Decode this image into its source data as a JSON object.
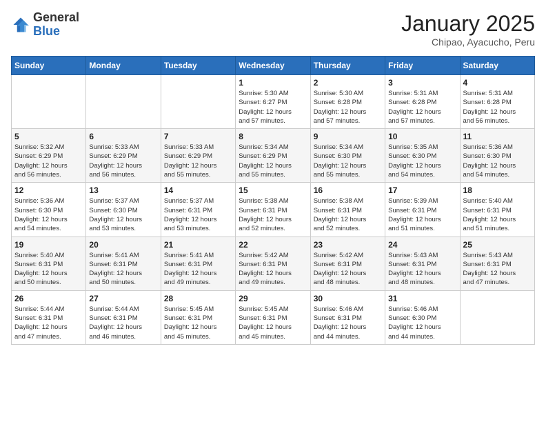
{
  "logo": {
    "general": "General",
    "blue": "Blue"
  },
  "header": {
    "month": "January 2025",
    "location": "Chipao, Ayacucho, Peru"
  },
  "days_of_week": [
    "Sunday",
    "Monday",
    "Tuesday",
    "Wednesday",
    "Thursday",
    "Friday",
    "Saturday"
  ],
  "weeks": [
    [
      {
        "day": "",
        "info": ""
      },
      {
        "day": "",
        "info": ""
      },
      {
        "day": "",
        "info": ""
      },
      {
        "day": "1",
        "info": "Sunrise: 5:30 AM\nSunset: 6:27 PM\nDaylight: 12 hours\nand 57 minutes."
      },
      {
        "day": "2",
        "info": "Sunrise: 5:30 AM\nSunset: 6:28 PM\nDaylight: 12 hours\nand 57 minutes."
      },
      {
        "day": "3",
        "info": "Sunrise: 5:31 AM\nSunset: 6:28 PM\nDaylight: 12 hours\nand 57 minutes."
      },
      {
        "day": "4",
        "info": "Sunrise: 5:31 AM\nSunset: 6:28 PM\nDaylight: 12 hours\nand 56 minutes."
      }
    ],
    [
      {
        "day": "5",
        "info": "Sunrise: 5:32 AM\nSunset: 6:29 PM\nDaylight: 12 hours\nand 56 minutes."
      },
      {
        "day": "6",
        "info": "Sunrise: 5:33 AM\nSunset: 6:29 PM\nDaylight: 12 hours\nand 56 minutes."
      },
      {
        "day": "7",
        "info": "Sunrise: 5:33 AM\nSunset: 6:29 PM\nDaylight: 12 hours\nand 55 minutes."
      },
      {
        "day": "8",
        "info": "Sunrise: 5:34 AM\nSunset: 6:29 PM\nDaylight: 12 hours\nand 55 minutes."
      },
      {
        "day": "9",
        "info": "Sunrise: 5:34 AM\nSunset: 6:30 PM\nDaylight: 12 hours\nand 55 minutes."
      },
      {
        "day": "10",
        "info": "Sunrise: 5:35 AM\nSunset: 6:30 PM\nDaylight: 12 hours\nand 54 minutes."
      },
      {
        "day": "11",
        "info": "Sunrise: 5:36 AM\nSunset: 6:30 PM\nDaylight: 12 hours\nand 54 minutes."
      }
    ],
    [
      {
        "day": "12",
        "info": "Sunrise: 5:36 AM\nSunset: 6:30 PM\nDaylight: 12 hours\nand 54 minutes."
      },
      {
        "day": "13",
        "info": "Sunrise: 5:37 AM\nSunset: 6:30 PM\nDaylight: 12 hours\nand 53 minutes."
      },
      {
        "day": "14",
        "info": "Sunrise: 5:37 AM\nSunset: 6:31 PM\nDaylight: 12 hours\nand 53 minutes."
      },
      {
        "day": "15",
        "info": "Sunrise: 5:38 AM\nSunset: 6:31 PM\nDaylight: 12 hours\nand 52 minutes."
      },
      {
        "day": "16",
        "info": "Sunrise: 5:38 AM\nSunset: 6:31 PM\nDaylight: 12 hours\nand 52 minutes."
      },
      {
        "day": "17",
        "info": "Sunrise: 5:39 AM\nSunset: 6:31 PM\nDaylight: 12 hours\nand 51 minutes."
      },
      {
        "day": "18",
        "info": "Sunrise: 5:40 AM\nSunset: 6:31 PM\nDaylight: 12 hours\nand 51 minutes."
      }
    ],
    [
      {
        "day": "19",
        "info": "Sunrise: 5:40 AM\nSunset: 6:31 PM\nDaylight: 12 hours\nand 50 minutes."
      },
      {
        "day": "20",
        "info": "Sunrise: 5:41 AM\nSunset: 6:31 PM\nDaylight: 12 hours\nand 50 minutes."
      },
      {
        "day": "21",
        "info": "Sunrise: 5:41 AM\nSunset: 6:31 PM\nDaylight: 12 hours\nand 49 minutes."
      },
      {
        "day": "22",
        "info": "Sunrise: 5:42 AM\nSunset: 6:31 PM\nDaylight: 12 hours\nand 49 minutes."
      },
      {
        "day": "23",
        "info": "Sunrise: 5:42 AM\nSunset: 6:31 PM\nDaylight: 12 hours\nand 48 minutes."
      },
      {
        "day": "24",
        "info": "Sunrise: 5:43 AM\nSunset: 6:31 PM\nDaylight: 12 hours\nand 48 minutes."
      },
      {
        "day": "25",
        "info": "Sunrise: 5:43 AM\nSunset: 6:31 PM\nDaylight: 12 hours\nand 47 minutes."
      }
    ],
    [
      {
        "day": "26",
        "info": "Sunrise: 5:44 AM\nSunset: 6:31 PM\nDaylight: 12 hours\nand 47 minutes."
      },
      {
        "day": "27",
        "info": "Sunrise: 5:44 AM\nSunset: 6:31 PM\nDaylight: 12 hours\nand 46 minutes."
      },
      {
        "day": "28",
        "info": "Sunrise: 5:45 AM\nSunset: 6:31 PM\nDaylight: 12 hours\nand 45 minutes."
      },
      {
        "day": "29",
        "info": "Sunrise: 5:45 AM\nSunset: 6:31 PM\nDaylight: 12 hours\nand 45 minutes."
      },
      {
        "day": "30",
        "info": "Sunrise: 5:46 AM\nSunset: 6:31 PM\nDaylight: 12 hours\nand 44 minutes."
      },
      {
        "day": "31",
        "info": "Sunrise: 5:46 AM\nSunset: 6:30 PM\nDaylight: 12 hours\nand 44 minutes."
      },
      {
        "day": "",
        "info": ""
      }
    ]
  ]
}
